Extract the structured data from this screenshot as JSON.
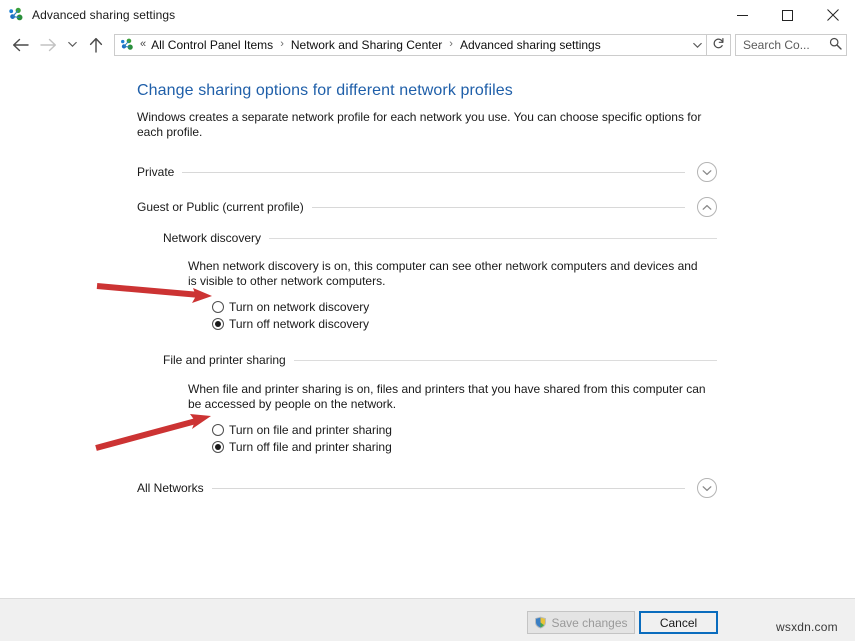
{
  "window": {
    "title": "Advanced sharing settings",
    "app_icon": "network-sharing-icon",
    "controls": {
      "minimize": "minimize-icon",
      "maximize": "maximize-icon",
      "close": "close-icon"
    }
  },
  "nav": {
    "back": "back-arrow-icon",
    "forward": "forward-arrow-icon",
    "recent": "chevron-down-icon",
    "up": "up-arrow-icon",
    "breadcrumb_icon": "network-sharing-icon",
    "breadcrumb_overflow": "«",
    "breadcrumbs": [
      "All Control Panel Items",
      "Network and Sharing Center",
      "Advanced sharing settings"
    ],
    "separator": "›",
    "address_dropdown": "chevron-down-icon",
    "refresh": "refresh-icon",
    "search_placeholder": "Search Co...",
    "search_value": "",
    "search_icon": "search-icon"
  },
  "page": {
    "heading": "Change sharing options for different network profiles",
    "heading_color": "#1f5fa9",
    "description": "Windows creates a separate network profile for each network you use. You can choose specific options for each profile."
  },
  "profiles": [
    {
      "label": "Private",
      "expanded": false,
      "toggle_icon": "chevron-down-icon"
    },
    {
      "label": "Guest or Public (current profile)",
      "expanded": true,
      "toggle_icon": "chevron-up-icon"
    },
    {
      "label": "All Networks",
      "expanded": false,
      "toggle_icon": "chevron-down-icon"
    }
  ],
  "sections": [
    {
      "title": "Network discovery",
      "description": "When network discovery is on, this computer can see other network computers and devices and is visible to other network computers.",
      "options": [
        {
          "label": "Turn on network discovery",
          "selected": false
        },
        {
          "label": "Turn off network discovery",
          "selected": true
        }
      ]
    },
    {
      "title": "File and printer sharing",
      "description": "When file and printer sharing is on, files and printers that you have shared from this computer can be accessed by people on the network.",
      "options": [
        {
          "label": "Turn on file and printer sharing",
          "selected": false
        },
        {
          "label": "Turn off file and printer sharing",
          "selected": true
        }
      ]
    }
  ],
  "annotations": {
    "arrow_color": "#cc3333",
    "arrows": [
      {
        "name": "arrow-to-network-discovery-radios"
      },
      {
        "name": "arrow-to-file-printer-sharing-radios"
      }
    ]
  },
  "footer": {
    "save_label": "Save changes",
    "save_enabled": false,
    "save_icon": "uac-shield-icon",
    "cancel_label": "Cancel",
    "cancel_focused": true,
    "focus_color": "#0a6cbd"
  },
  "watermark": "wsxdn.com"
}
